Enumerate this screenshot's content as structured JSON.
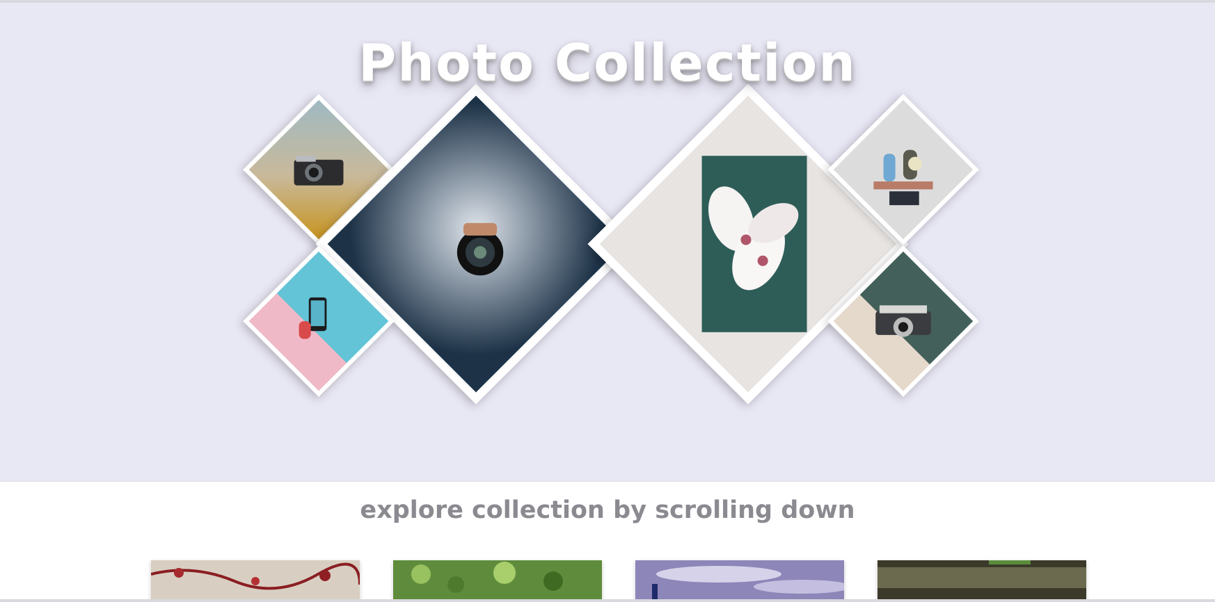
{
  "hero": {
    "title": "Photo Collection",
    "background": "#e8e7f4"
  },
  "gallery": {
    "tiles": [
      {
        "name": "vintage-camera-photo",
        "icon": "camera-icon"
      },
      {
        "name": "smoke-camera-photo",
        "icon": "camera-icon"
      },
      {
        "name": "magnolia-flower-photo",
        "icon": "flower-icon"
      },
      {
        "name": "vases-shelf-photo",
        "icon": "vase-icon"
      },
      {
        "name": "phone-pool-photo",
        "icon": "phone-icon"
      },
      {
        "name": "zenit-camera-photo",
        "icon": "camera-icon"
      }
    ]
  },
  "explore": {
    "subtitle": "explore collection by scrolling down"
  },
  "thumbnails": [
    {
      "name": "thumb-red-leaves"
    },
    {
      "name": "thumb-green-foliage"
    },
    {
      "name": "thumb-purple-sky"
    },
    {
      "name": "thumb-tree-trunk"
    }
  ]
}
